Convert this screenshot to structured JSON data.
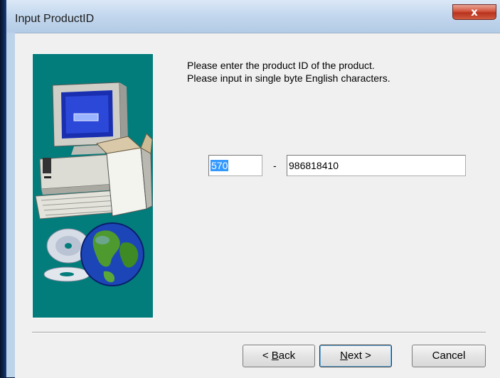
{
  "window": {
    "title": "Input ProductID",
    "close_glyph": "x"
  },
  "instructions": {
    "line1": "Please enter the product ID of the product.",
    "line2": "Please input in single byte English characters."
  },
  "product_id": {
    "part1": "570",
    "separator": "-",
    "part2": "986818410"
  },
  "buttons": {
    "back_mnemonic": "B",
    "back_rest": "ack",
    "back_prefix": "< ",
    "next_mnemonic": "N",
    "next_rest": "ext >",
    "cancel": "Cancel"
  },
  "colors": {
    "illustration_bg": "#037c7c",
    "selection": "#3399ff"
  },
  "icons": [
    "computer-icon",
    "cd-disc-icon",
    "globe-icon",
    "close-icon"
  ]
}
